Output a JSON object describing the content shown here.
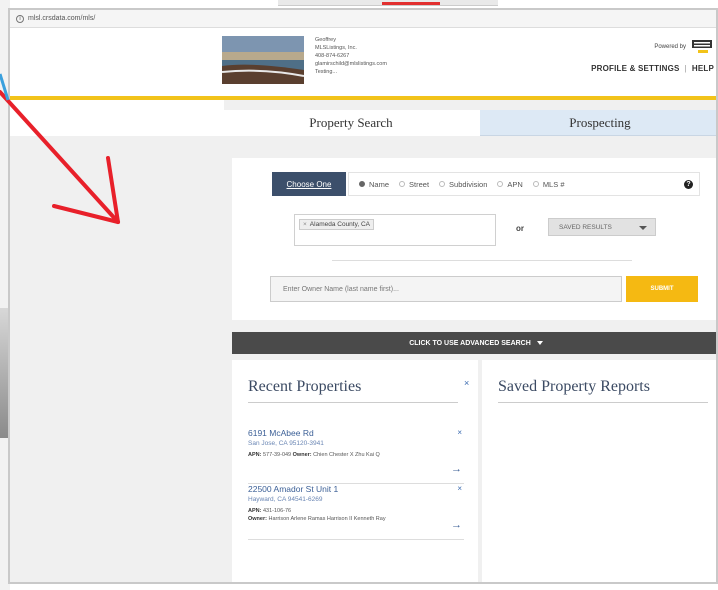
{
  "browser": {
    "url": "mlsl.crsdata.com/mls/"
  },
  "header": {
    "agent_lines": [
      "Geoffrey",
      "MLSListings, Inc.",
      "408-874-6267",
      "glamirschild@mlslistings.com",
      "Testing..."
    ],
    "powered_by": "Powered by",
    "profile_label": "PROFILE & SETTINGS",
    "help_label": "HELP",
    "separator": "|"
  },
  "tabs": [
    {
      "label": "Property Search",
      "active": true
    },
    {
      "label": "Prospecting",
      "active": false
    }
  ],
  "search": {
    "choose_label": "Choose One",
    "options": [
      {
        "label": "Name",
        "selected": true
      },
      {
        "label": "Street",
        "selected": false
      },
      {
        "label": "Subdivision",
        "selected": false
      },
      {
        "label": "APN",
        "selected": false
      },
      {
        "label": "MLS #",
        "selected": false
      }
    ],
    "help_glyph": "?",
    "county_tag": "Alameda County, CA",
    "tag_remove": "×",
    "or_label": "or",
    "saved_results": "SAVED RESULTS",
    "owner_placeholder": "Enter Owner Name (last name first)...",
    "submit_label": "SUBMIT"
  },
  "advanced": {
    "label": "CLICK TO USE ADVANCED SEARCH"
  },
  "recent": {
    "title": "Recent Properties",
    "close_glyph": "×",
    "arrow_glyph": "→",
    "items": [
      {
        "address": "6191 McAbee Rd",
        "city": "San Jose, CA 95120-3941",
        "apn_label": "APN:",
        "apn": "577-39-049",
        "owner_label": "Owner:",
        "owner": "Chien Chester X Zhu Kai Q"
      },
      {
        "address": "22500 Amador St Unit 1",
        "city": "Hayward, CA 94541-6269",
        "apn_label": "APN:",
        "apn": "431-106-76",
        "owner_label": "Owner:",
        "owner": "Harrison Arlene Ramas Harrison II Kenneth Ray"
      }
    ]
  },
  "saved_reports": {
    "title": "Saved Property Reports"
  },
  "colors": {
    "accent_yellow": "#f2c31a",
    "submit_yellow": "#f5b912",
    "navy": "#3c4f6b",
    "link_blue": "#3b5f96",
    "annotation_red": "#e8202a"
  }
}
